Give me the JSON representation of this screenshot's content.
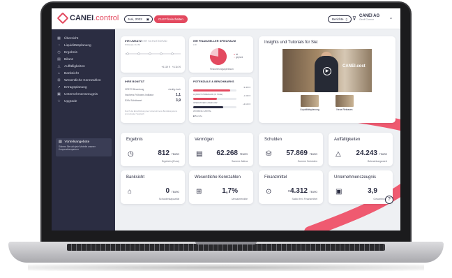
{
  "header": {
    "logo_main": "CANEI",
    "logo_accent": ".control",
    "date_value": "Juni, 2022",
    "cta_label": "CLEP freischalten",
    "report_label": "Berichte",
    "company_name": "CANEI AG",
    "company_sub": "Geoff Connor"
  },
  "sidebar": {
    "items": [
      {
        "label": "Übersicht",
        "icon": "grid-icon"
      },
      {
        "label": "Liquiditätsplanung",
        "icon": "chart-icon"
      },
      {
        "label": "Ergebnis",
        "icon": "clock-icon"
      },
      {
        "label": "Bilanz",
        "icon": "docs-icon"
      },
      {
        "label": "Auffälligkeiten",
        "icon": "alert-icon"
      },
      {
        "label": "Banksicht",
        "icon": "bank-icon"
      },
      {
        "label": "Wesentliche Kennzahlen",
        "icon": "grid-plus-icon"
      },
      {
        "label": "Ertragsplanung",
        "icon": "trend-icon"
      },
      {
        "label": "Unternehmenszeugnis",
        "icon": "certificate-icon"
      },
      {
        "label": "Upgrade",
        "icon": "star-icon"
      }
    ],
    "promo_title": "Vorteilsangebote",
    "promo_text": "Sichern Sie sich jetzt Vorteile unserer Kooperationspartner"
  },
  "cards": {
    "umsatz": {
      "title": "IHR UMSATZ",
      "title_secondary": "IHR SCHUTZGRAD",
      "sub": "6 Monate / 12 M",
      "delta1": "+6.119 €",
      "delta2": "+8.110 €"
    },
    "spielraum": {
      "title": "IHR FINANZIELLER SPIELRAUM",
      "sub": "in €",
      "donut_value": 0.78,
      "legend1": "Ist",
      "legend2": "geplant",
      "footer": "Finanzierungsspielraum"
    },
    "bonitaet": {
      "title": "IHRE BONITÄT",
      "rows": [
        {
          "label": "CREFO Bewertung",
          "value": "niedrig-hoch"
        },
        {
          "label": "Insolvenz-Frühwarn-Indikator",
          "value": "1,1"
        },
        {
          "label": "EXIM Schätzwert",
          "value": "3,9"
        }
      ],
      "note": "Durch die Einschätzung des Unternehmens Bonitätssystems prozentualer Vergleich"
    },
    "potenziale": {
      "title": "POTENZIALE & BENCHMARKS",
      "rows": [
        {
          "label": "LIQUIDITÄTSBEDARF (IN TAGE)",
          "value": "-9.463 €",
          "fill": 0.85
        },
        {
          "label": "OPERATIVER CASHFLOW",
          "value": "-1.340 €",
          "fill": 0.55
        },
        {
          "label": "WORKING CAPITAL",
          "value": "+3.100 €",
          "fill": 0.7
        }
      ],
      "legend": "Branche"
    },
    "video": {
      "title": "Insights und Tutorials für Sie:",
      "overlay": "CANEI.cost",
      "thumb1": "Liquiditätsplanung",
      "thumb2": "Neue Releases"
    }
  },
  "kpis": [
    {
      "title": "Ergebnis",
      "icon": "clock-icon",
      "value": "812",
      "unit": "TEURO",
      "label": "Ergebnis (Euro)"
    },
    {
      "title": "Vermögen",
      "icon": "docs-icon",
      "value": "62.268",
      "unit": "TEURO",
      "label": "Summe Aktiva"
    },
    {
      "title": "Schulden",
      "icon": "money-icon",
      "value": "57.869",
      "unit": "TEURO",
      "label": "Summe Schulden"
    },
    {
      "title": "Auffälligkeiten",
      "icon": "alert-icon",
      "value": "24.243",
      "unit": "TEURO",
      "label": "Betrachtungswert"
    },
    {
      "title": "Banksicht",
      "icon": "bank-icon",
      "value": "0",
      "unit": "TEURO",
      "label": "Schuldenkapazität"
    },
    {
      "title": "Wesentliche Kennzahlen",
      "icon": "grid-plus-icon",
      "value": "1,7%",
      "unit": "",
      "label": "Umsatzrendite"
    },
    {
      "title": "Finanzmittel",
      "icon": "gauge-icon",
      "value": "-4.312",
      "unit": "TEURO",
      "label": "Saldo frei. Finanzmittel"
    },
    {
      "title": "Unternehmenszeugnis",
      "icon": "certificate-icon",
      "value": "3,9",
      "unit": "",
      "label": "Gesamtnote"
    }
  ],
  "help_label": "?",
  "colors": {
    "accent": "#e3495f",
    "sidebar": "#2b2d42",
    "background": "#eef0f3"
  }
}
